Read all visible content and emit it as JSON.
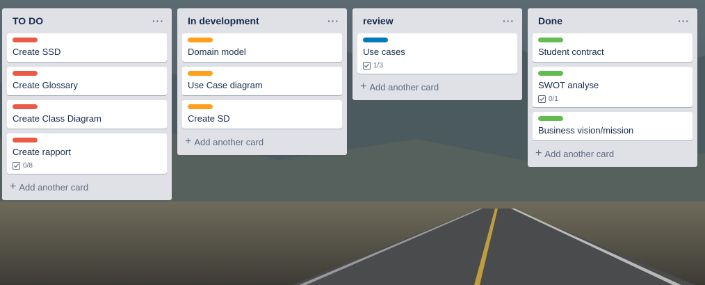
{
  "colors": {
    "red": "#eb5a46",
    "orange": "#ff9f1a",
    "blue": "#0079bf",
    "green": "#61bd4f"
  },
  "lists": [
    {
      "title": "TO DO",
      "menu_icon": "more-icon",
      "cards": [
        {
          "label_color": "red",
          "title": "Create SSD"
        },
        {
          "label_color": "red",
          "title": "Create Glossary"
        },
        {
          "label_color": "red",
          "title": "Create Class Diagram"
        },
        {
          "label_color": "red",
          "title": "Create rapport",
          "checklist": "0/8"
        }
      ],
      "add_label": "Add another card"
    },
    {
      "title": "In development",
      "menu_icon": "more-icon",
      "cards": [
        {
          "label_color": "orange",
          "title": "Domain model"
        },
        {
          "label_color": "orange",
          "title": "Use Case diagram"
        },
        {
          "label_color": "orange",
          "title": "Create SD"
        }
      ],
      "add_label": "Add another card"
    },
    {
      "title": "review",
      "menu_icon": "more-icon",
      "cards": [
        {
          "label_color": "blue",
          "title": "Use cases",
          "checklist": "1/3"
        }
      ],
      "add_label": "Add another card"
    },
    {
      "title": "Done",
      "menu_icon": "more-icon",
      "cards": [
        {
          "label_color": "green",
          "title": "Student contract"
        },
        {
          "label_color": "green",
          "title": "SWOT analyse",
          "checklist": "0/1"
        },
        {
          "label_color": "green",
          "title": "Business vision/mission"
        }
      ],
      "add_label": "Add another card"
    }
  ]
}
